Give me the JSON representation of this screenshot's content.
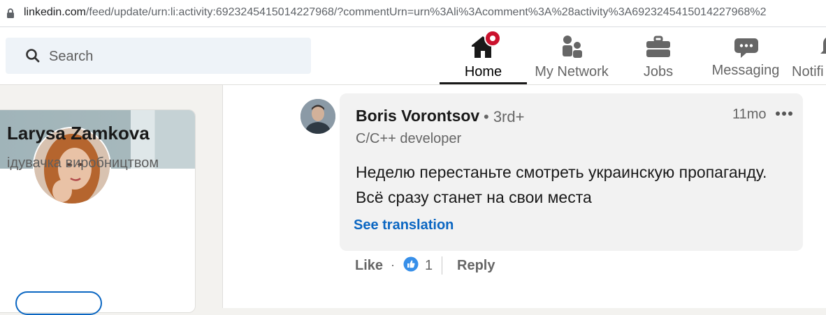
{
  "browser": {
    "url_host": "linkedin.com",
    "url_rest": "/feed/update/urn:li:activity:6923245415014227968/?commentUrn=urn%3Ali%3Acomment%3A%28activity%3A6923245415014227968%2"
  },
  "nav": {
    "search_placeholder": "Search",
    "items": [
      {
        "label": "Home",
        "icon": "home-icon",
        "active": true
      },
      {
        "label": "My Network",
        "icon": "people-icon"
      },
      {
        "label": "Jobs",
        "icon": "briefcase-icon"
      },
      {
        "label": "Messaging",
        "icon": "chat-icon"
      },
      {
        "label": "Notifi",
        "icon": "bell-icon"
      }
    ]
  },
  "profile": {
    "name": "Larysa Zamkova",
    "headline": "ідувачка виробництвом"
  },
  "comment": {
    "author": "Boris Vorontsov",
    "degree": "• 3rd+",
    "headline": "C/C++ developer",
    "time": "11mo",
    "text": "Неделю перестаньте смотреть украинскую пропаганду. Всё сразу станет на свои места",
    "see_translation": "See translation",
    "like_label": "Like",
    "separator": "·",
    "reaction_count": "1",
    "reply_label": "Reply"
  },
  "colors": {
    "accent": "#0a66c2",
    "notification": "#cb112d",
    "background": "#f3f2ef"
  }
}
